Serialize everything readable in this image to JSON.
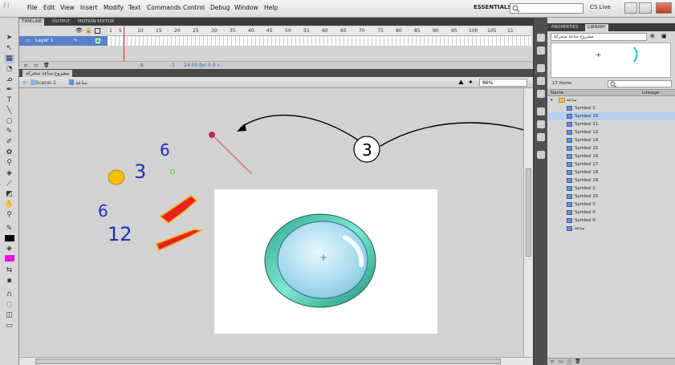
{
  "app": {
    "logo": "Fl"
  },
  "menu": [
    "File",
    "Edit",
    "View",
    "Insert",
    "Modify",
    "Text",
    "Commands",
    "Control",
    "Debug",
    "Window",
    "Help"
  ],
  "topbar": {
    "essentials": "ESSENTIALS ▾",
    "cslive": "CS Live"
  },
  "timeline": {
    "tabs": [
      "TIMELINE",
      "OUTPUT",
      "MOTION EDITOR"
    ],
    "frames": [
      "1",
      "5",
      "10",
      "15",
      "20",
      "25",
      "30",
      "35",
      "40",
      "45",
      "50",
      "55",
      "60",
      "65",
      "70",
      "75",
      "80",
      "85",
      "90",
      "95",
      "100",
      "105",
      "11"
    ],
    "layer": "Layer 1",
    "status": {
      "frame": "1",
      "fps": "24.00 fps",
      "time": "0.0 s"
    }
  },
  "document": {
    "tab": "مشروع ساعة متحركة",
    "scene": "Scene 1",
    "symbol": "ساعة",
    "zoom": "86%"
  },
  "stage": {
    "texts": [
      "6",
      "3",
      "6",
      "12"
    ],
    "callout": "3"
  },
  "library": {
    "tabs": [
      "PROPERTIES",
      "LIBRARY"
    ],
    "doc": "مشروع ساعة متحركة",
    "count": "17 items",
    "col_name": "Name",
    "col_linkage": "Linkage",
    "folder": "ساعة",
    "items": [
      "Symbol 1",
      "Symbol 10",
      "Symbol 11",
      "Symbol 12",
      "Symbol 14",
      "Symbol 15",
      "Symbol 16",
      "Symbol 17",
      "Symbol 18",
      "Symbol 19",
      "Symbol 2",
      "Symbol 20",
      "Symbol 3",
      "Symbol 4",
      "Symbol 9",
      "ساعة"
    ],
    "selected_index": 1
  },
  "colors": {
    "accent": "#5a7fc7",
    "selected_row": "#b9cff0",
    "clock_rim": "#3cc6b0",
    "clock_face": "#a9dcef"
  }
}
